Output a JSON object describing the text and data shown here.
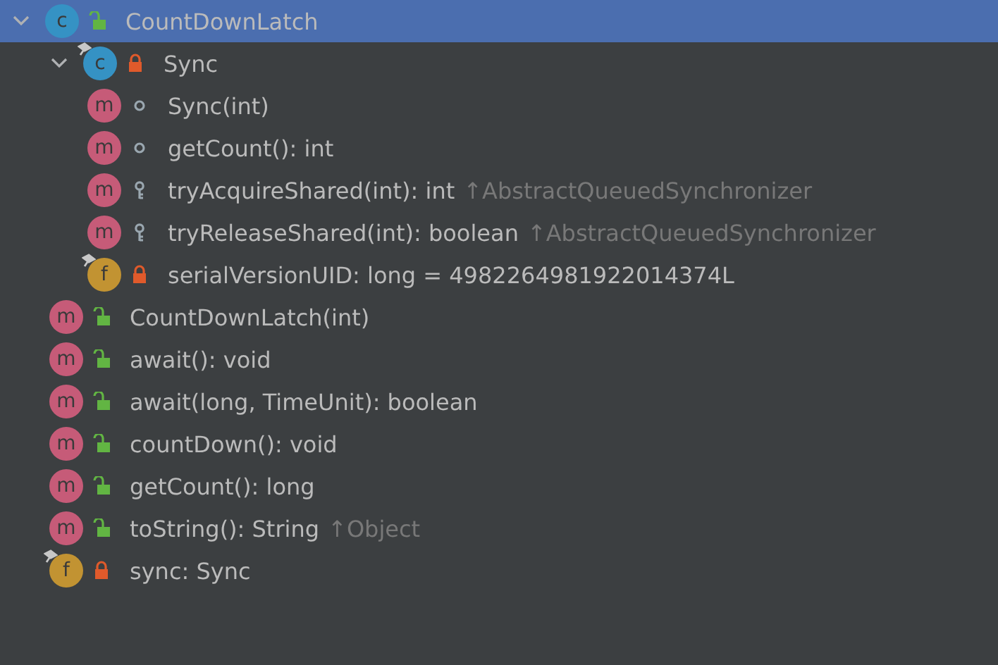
{
  "tree": [
    {
      "kind": "class",
      "badge": "c",
      "access": {
        "kind": "public"
      },
      "final": false,
      "label": "CountDownLatch",
      "selected": true,
      "expanded": true,
      "children": [
        {
          "kind": "class",
          "badge": "c",
          "access": {
            "kind": "private"
          },
          "final": true,
          "label": "Sync",
          "selected": false,
          "expanded": true,
          "children": [
            {
              "kind": "method",
              "badge": "m",
              "access": {
                "kind": "package"
              },
              "final": false,
              "label": "Sync(int)",
              "selected": false
            },
            {
              "kind": "method",
              "badge": "m",
              "access": {
                "kind": "package"
              },
              "final": false,
              "label": "getCount(): int",
              "selected": false
            },
            {
              "kind": "method",
              "badge": "m",
              "access": {
                "kind": "protected"
              },
              "final": false,
              "label": "tryAcquireShared(int): int",
              "inherited": "↑AbstractQueuedSynchronizer",
              "selected": false
            },
            {
              "kind": "method",
              "badge": "m",
              "access": {
                "kind": "protected"
              },
              "final": false,
              "label": "tryReleaseShared(int): boolean",
              "inherited": "↑AbstractQueuedSynchronizer",
              "selected": false
            },
            {
              "kind": "field",
              "badge": "f",
              "access": {
                "kind": "private"
              },
              "final": true,
              "label": "serialVersionUID: long = 4982264981922014374L",
              "selected": false
            }
          ]
        },
        {
          "kind": "method",
          "badge": "m",
          "access": {
            "kind": "public"
          },
          "final": false,
          "label": "CountDownLatch(int)",
          "selected": false
        },
        {
          "kind": "method",
          "badge": "m",
          "access": {
            "kind": "public"
          },
          "final": false,
          "label": "await(): void",
          "selected": false
        },
        {
          "kind": "method",
          "badge": "m",
          "access": {
            "kind": "public"
          },
          "final": false,
          "label": "await(long, TimeUnit): boolean",
          "selected": false
        },
        {
          "kind": "method",
          "badge": "m",
          "access": {
            "kind": "public"
          },
          "final": false,
          "label": "countDown(): void",
          "selected": false
        },
        {
          "kind": "method",
          "badge": "m",
          "access": {
            "kind": "public"
          },
          "final": false,
          "label": "getCount(): long",
          "selected": false
        },
        {
          "kind": "method",
          "badge": "m",
          "access": {
            "kind": "public"
          },
          "final": false,
          "label": "toString(): String",
          "inherited": "↑Object",
          "selected": false
        },
        {
          "kind": "field",
          "badge": "f",
          "access": {
            "kind": "private"
          },
          "final": true,
          "label": "sync: Sync",
          "selected": false
        }
      ]
    }
  ]
}
